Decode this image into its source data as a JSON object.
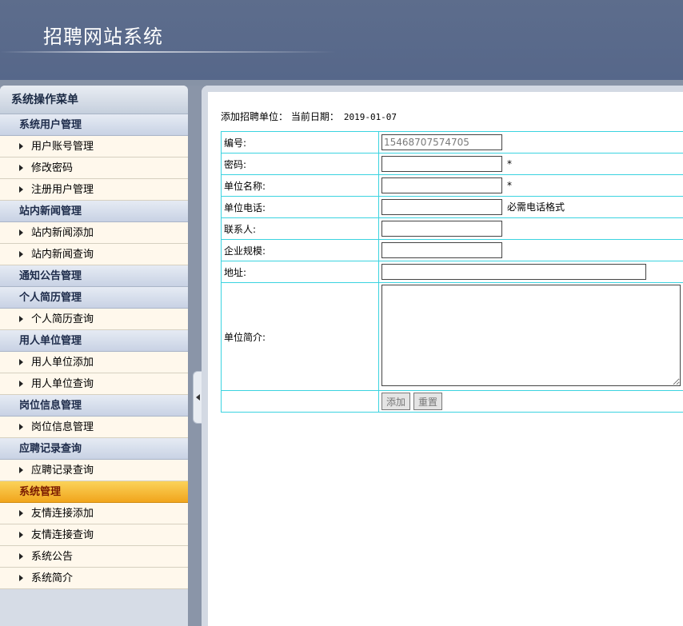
{
  "header": {
    "title": "招聘网站系统"
  },
  "sidebar": {
    "title": "系统操作菜单",
    "groups": [
      {
        "label": "系统用户管理",
        "items": [
          "用户账号管理",
          "修改密码",
          "注册用户管理"
        ]
      },
      {
        "label": "站内新闻管理",
        "items": [
          "站内新闻添加",
          "站内新闻查询"
        ]
      },
      {
        "label": "通知公告管理",
        "items": []
      },
      {
        "label": "个人简历管理",
        "items": [
          "个人简历查询"
        ]
      },
      {
        "label": "用人单位管理",
        "items": [
          "用人单位添加",
          "用人单位查询"
        ]
      },
      {
        "label": "岗位信息管理",
        "items": [
          "岗位信息管理"
        ]
      },
      {
        "label": "应聘记录查询",
        "items": [
          "应聘记录查询"
        ]
      },
      {
        "label": "系统管理",
        "items": [
          "友情连接添加",
          "友情连接查询",
          "系统公告",
          "系统简介"
        ]
      }
    ]
  },
  "main": {
    "caption": "添加招聘单位： 当前日期：",
    "date": "2019-01-07",
    "form": {
      "id_label": "编号:",
      "id_value": "15468707574705",
      "password_label": "密码:",
      "required_mark": "*",
      "name_label": "单位名称:",
      "phone_label": "单位电话:",
      "phone_hint": "必需电话格式",
      "contact_label": "联系人:",
      "scale_label": "企业规模:",
      "address_label": "地址:",
      "intro_label": "单位简介:",
      "submit_label": "添加",
      "reset_label": "重置"
    }
  },
  "colors": {
    "header": "#5d6d8c",
    "active_group": "#f1a51c",
    "table_border": "#3bd3e0"
  }
}
